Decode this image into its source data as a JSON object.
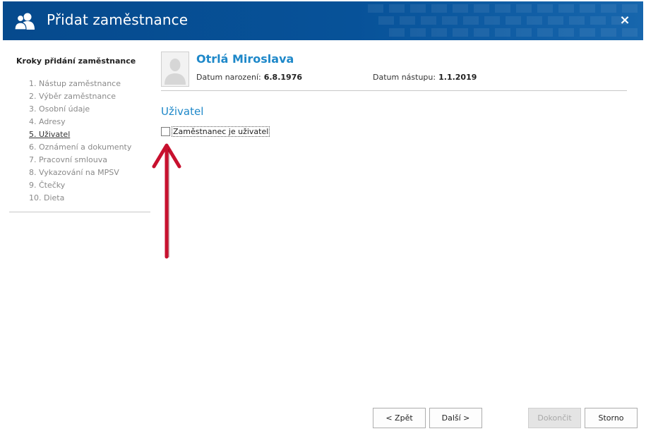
{
  "dialog": {
    "title": "Přidat zaměstnance",
    "close_label": "×"
  },
  "sidebar": {
    "title": "Kroky přidání zaměstnance",
    "steps": [
      "1. Nástup zaměstnance",
      "2. Výběr zaměstnance",
      "3. Osobní údaje",
      "4. Adresy",
      "5. Uživatel",
      "6. Oznámení a dokumenty",
      "7. Pracovní smlouva",
      "8. Vykazování na MPSV",
      "9. Čtečky",
      "10. Dieta"
    ],
    "active_step": 5
  },
  "employee": {
    "name": "Otrlá Miroslava",
    "birth_label": "Datum narození:",
    "birth_value": "6.8.1976",
    "start_label": "Datum nástupu:",
    "start_value": "1.1.2019"
  },
  "section": {
    "title": "Uživatel",
    "checkbox_label": "Zaměstnanec je uživatel",
    "checkbox_checked": false
  },
  "buttons": {
    "back": "< Zpět",
    "next": "Další >",
    "finish": "Dokončit",
    "cancel": "Storno"
  },
  "colors": {
    "titlebar": "#064a8d",
    "accent": "#1e88c9",
    "annotation_arrow": "#c8102e"
  },
  "icons": {
    "title": "users-icon",
    "close": "close-icon",
    "avatar": "person-placeholder-icon",
    "annotation": "arrow-up-annotation"
  }
}
